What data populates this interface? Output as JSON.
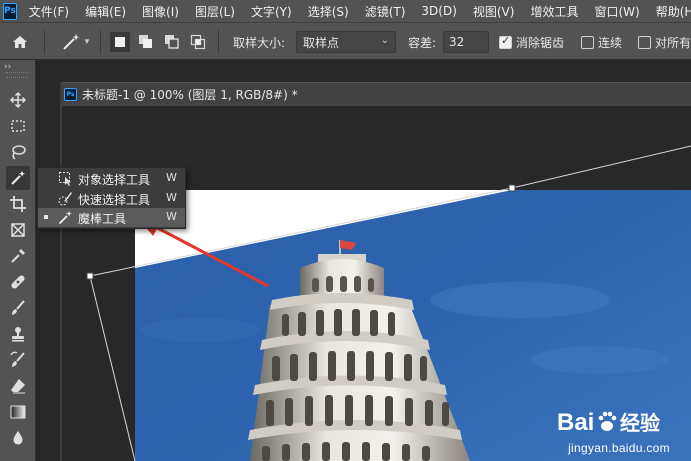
{
  "app": {
    "logo": "Ps"
  },
  "menu": [
    "文件(F)",
    "编辑(E)",
    "图像(I)",
    "图层(L)",
    "文字(Y)",
    "选择(S)",
    "滤镜(T)",
    "3D(D)",
    "视图(V)",
    "增效工具",
    "窗口(W)",
    "帮助(H)"
  ],
  "options": {
    "sample_size_label": "取样大小:",
    "sample_size_value": "取样点",
    "tolerance_label": "容差:",
    "tolerance_value": "32",
    "antialias_label": "消除锯齿",
    "antialias_checked": true,
    "contiguous_label": "连续",
    "contiguous_checked": false,
    "all_layers_label": "对所有"
  },
  "document": {
    "icon": "Ps",
    "title": "未标题-1 @ 100% (图层 1, RGB/8#) *"
  },
  "flyout": {
    "items": [
      {
        "label": "对象选择工具",
        "key": "W",
        "icon": "object-select-icon",
        "selected": false
      },
      {
        "label": "快速选择工具",
        "key": "W",
        "icon": "quick-select-icon",
        "selected": false
      },
      {
        "label": "魔棒工具",
        "key": "W",
        "icon": "magic-wand-icon",
        "selected": true
      }
    ]
  },
  "watermark": {
    "brand": "Bai 经验",
    "url": "jingyan.baidu.com"
  },
  "colors": {
    "ui_bg": "#535353",
    "canvas_bg": "#282828",
    "sky_blue": "#2b5ea8",
    "arrow_red": "#e5352d"
  }
}
